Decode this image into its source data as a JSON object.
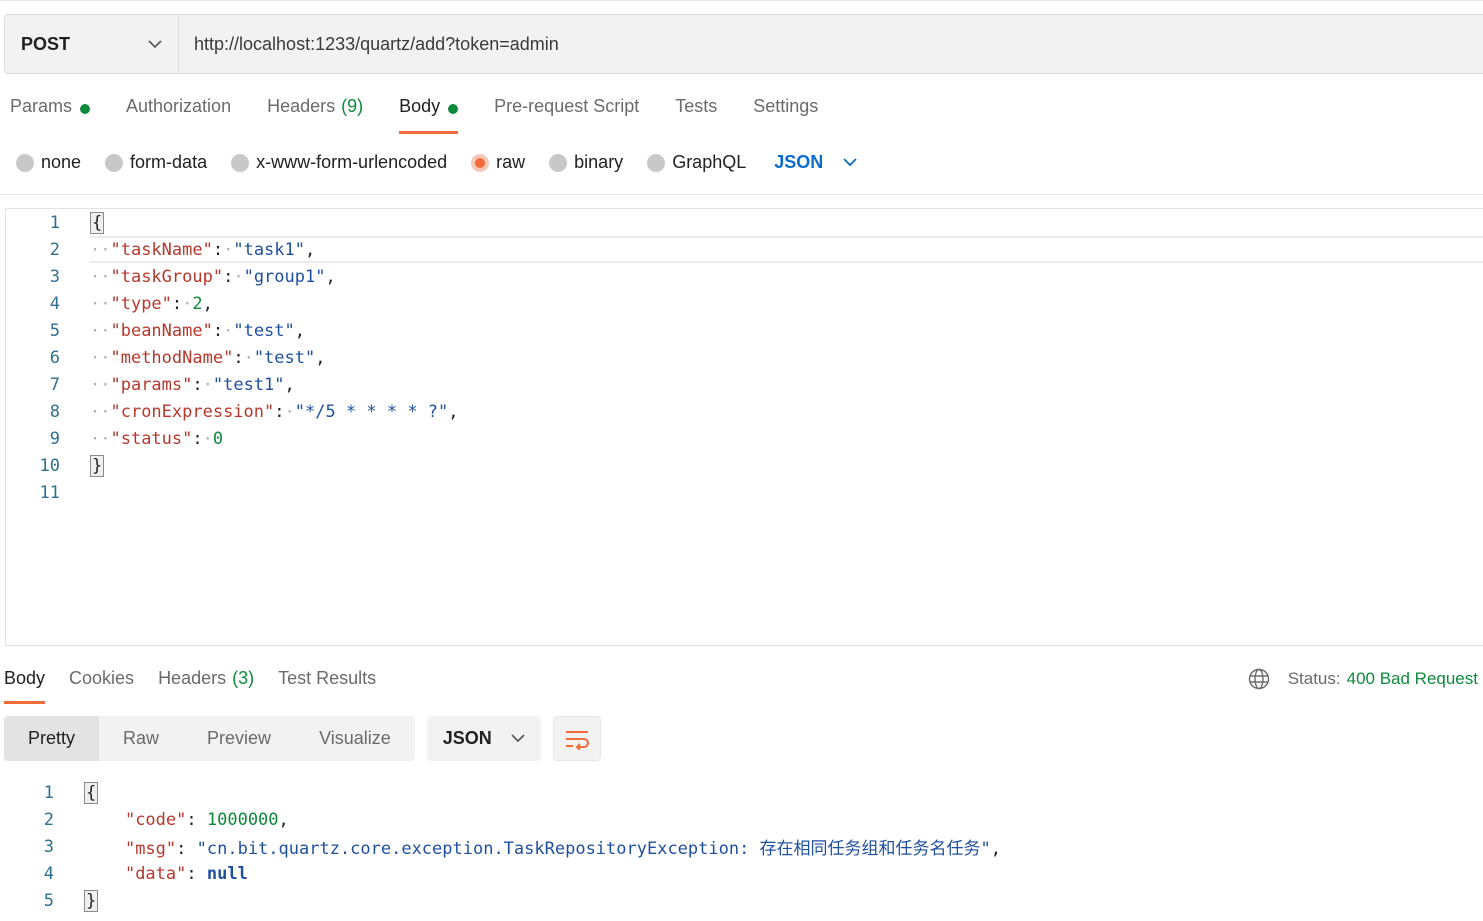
{
  "request": {
    "method": "POST",
    "url": "http://localhost:1233/quartz/add?token=admin"
  },
  "request_tabs": [
    {
      "label": "Params",
      "count": "",
      "dot": true,
      "active": false
    },
    {
      "label": "Authorization",
      "count": "",
      "dot": false,
      "active": false
    },
    {
      "label": "Headers",
      "count": "(9)",
      "dot": false,
      "active": false
    },
    {
      "label": "Body",
      "count": "",
      "dot": true,
      "active": true
    },
    {
      "label": "Pre-request Script",
      "count": "",
      "dot": false,
      "active": false
    },
    {
      "label": "Tests",
      "count": "",
      "dot": false,
      "active": false
    },
    {
      "label": "Settings",
      "count": "",
      "dot": false,
      "active": false
    }
  ],
  "body_types": [
    {
      "label": "none",
      "selected": false
    },
    {
      "label": "form-data",
      "selected": false
    },
    {
      "label": "x-www-form-urlencoded",
      "selected": false
    },
    {
      "label": "raw",
      "selected": true
    },
    {
      "label": "binary",
      "selected": false
    },
    {
      "label": "GraphQL",
      "selected": false
    }
  ],
  "body_format": "JSON",
  "request_body": {
    "line_numbers": [
      "1",
      "2",
      "3",
      "4",
      "5",
      "6",
      "7",
      "8",
      "9",
      "10",
      "11"
    ],
    "open_brace": "{",
    "close_brace": "}",
    "fields": [
      {
        "key": "\"taskName\"",
        "value": "\"task1\"",
        "type": "string",
        "comma": ","
      },
      {
        "key": "\"taskGroup\"",
        "value": "\"group1\"",
        "type": "string",
        "comma": ","
      },
      {
        "key": "\"type\"",
        "value": "2",
        "type": "number",
        "comma": ","
      },
      {
        "key": "\"beanName\"",
        "value": "\"test\"",
        "type": "string",
        "comma": ","
      },
      {
        "key": "\"methodName\"",
        "value": "\"test\"",
        "type": "string",
        "comma": ","
      },
      {
        "key": "\"params\"",
        "value": "\"test1\"",
        "type": "string",
        "comma": ","
      },
      {
        "key": "\"cronExpression\"",
        "value": "\"*/5 * * * * ?\"",
        "type": "string",
        "comma": ","
      },
      {
        "key": "\"status\"",
        "value": "0",
        "type": "number",
        "comma": ""
      }
    ]
  },
  "response_tabs": [
    {
      "label": "Body",
      "count": "",
      "active": true
    },
    {
      "label": "Cookies",
      "count": "",
      "active": false
    },
    {
      "label": "Headers",
      "count": "(3)",
      "active": false
    },
    {
      "label": "Test Results",
      "count": "",
      "active": false
    }
  ],
  "status": {
    "label": "Status:",
    "value": "400 Bad Request",
    "icon": "globe-icon"
  },
  "view_modes": [
    {
      "label": "Pretty",
      "active": true
    },
    {
      "label": "Raw",
      "active": false
    },
    {
      "label": "Preview",
      "active": false
    },
    {
      "label": "Visualize",
      "active": false
    }
  ],
  "response_format": "JSON",
  "response_body": {
    "line_numbers": [
      "1",
      "2",
      "3",
      "4",
      "5"
    ],
    "open_brace": "{",
    "close_brace": "}",
    "fields": [
      {
        "key": "\"code\"",
        "value": "1000000",
        "type": "number",
        "comma": ","
      },
      {
        "key": "\"msg\"",
        "value": "\"cn.bit.quartz.core.exception.TaskRepositoryException: 存在相同任务组和任务名任务\"",
        "type": "string",
        "comma": ","
      },
      {
        "key": "\"data\"",
        "value": "null",
        "type": "null",
        "comma": ""
      }
    ]
  },
  "colors": {
    "accent": "#f26b3a",
    "success": "#0f8a3c",
    "link": "#0b6bcb",
    "json_key": "#b8382d",
    "json_string": "#1f4f9f",
    "json_number": "#10883c"
  }
}
